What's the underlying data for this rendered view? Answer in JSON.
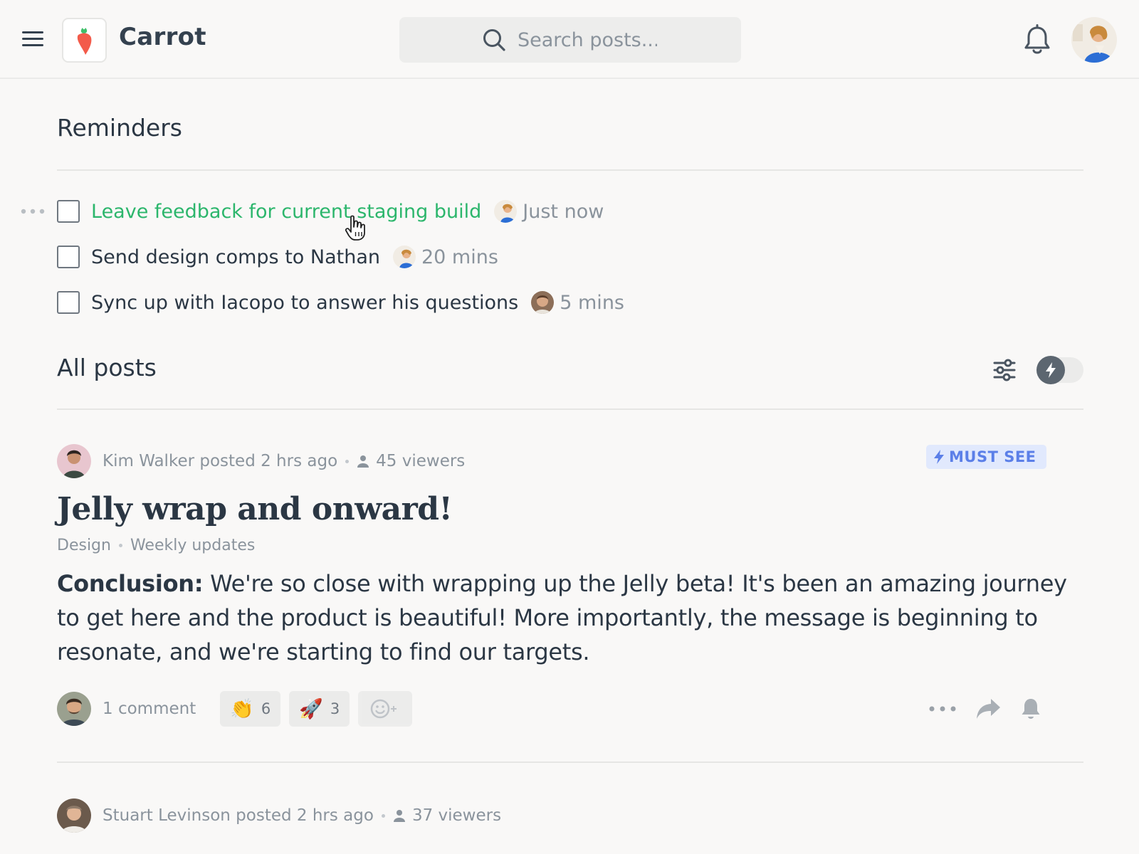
{
  "header": {
    "brand": "Carrot",
    "search_placeholder": "Search posts..."
  },
  "reminders": {
    "title": "Reminders",
    "items": [
      {
        "text": "Leave feedback for current staging build",
        "time": "Just now",
        "active": true
      },
      {
        "text": "Send design comps to Nathan",
        "time": "20 mins",
        "active": false
      },
      {
        "text": "Sync up with Iacopo to answer his questions",
        "time": "5 mins",
        "active": false
      }
    ]
  },
  "posts_section": {
    "title": "All posts"
  },
  "posts": [
    {
      "author": "Kim Walker",
      "posted": "posted 2 hrs ago",
      "viewers": "45 viewers",
      "badge": "MUST SEE",
      "title": "Jelly wrap and onward!",
      "tag_1": "Design",
      "tag_2": "Weekly updates",
      "body_lead": "Conclusion:",
      "body": " We're so close with wrapping up the Jelly beta! It's been an amazing journey to get here and the product is beautiful! More importantly, the message is beginning to resonate, and we're starting to find our targets.",
      "comments": "1 comment",
      "reactions": [
        {
          "emoji": "👏",
          "count": "6"
        },
        {
          "emoji": "🚀",
          "count": "3"
        }
      ]
    },
    {
      "author": "Stuart Levinson",
      "posted": "posted 2 hrs ago",
      "viewers": "37 viewers"
    }
  ],
  "colors": {
    "accent_green": "#2cb66c",
    "must_see_blue": "#5b7fe8",
    "text_dark": "#2b3744",
    "text_muted": "#8a939c"
  },
  "icons": [
    "menu-icon",
    "carrot-logo-icon",
    "search-icon",
    "bell-icon",
    "filter-icon",
    "lightning-icon",
    "person-icon",
    "more-icon",
    "share-icon",
    "follow-bell-icon",
    "add-reaction-icon"
  ]
}
